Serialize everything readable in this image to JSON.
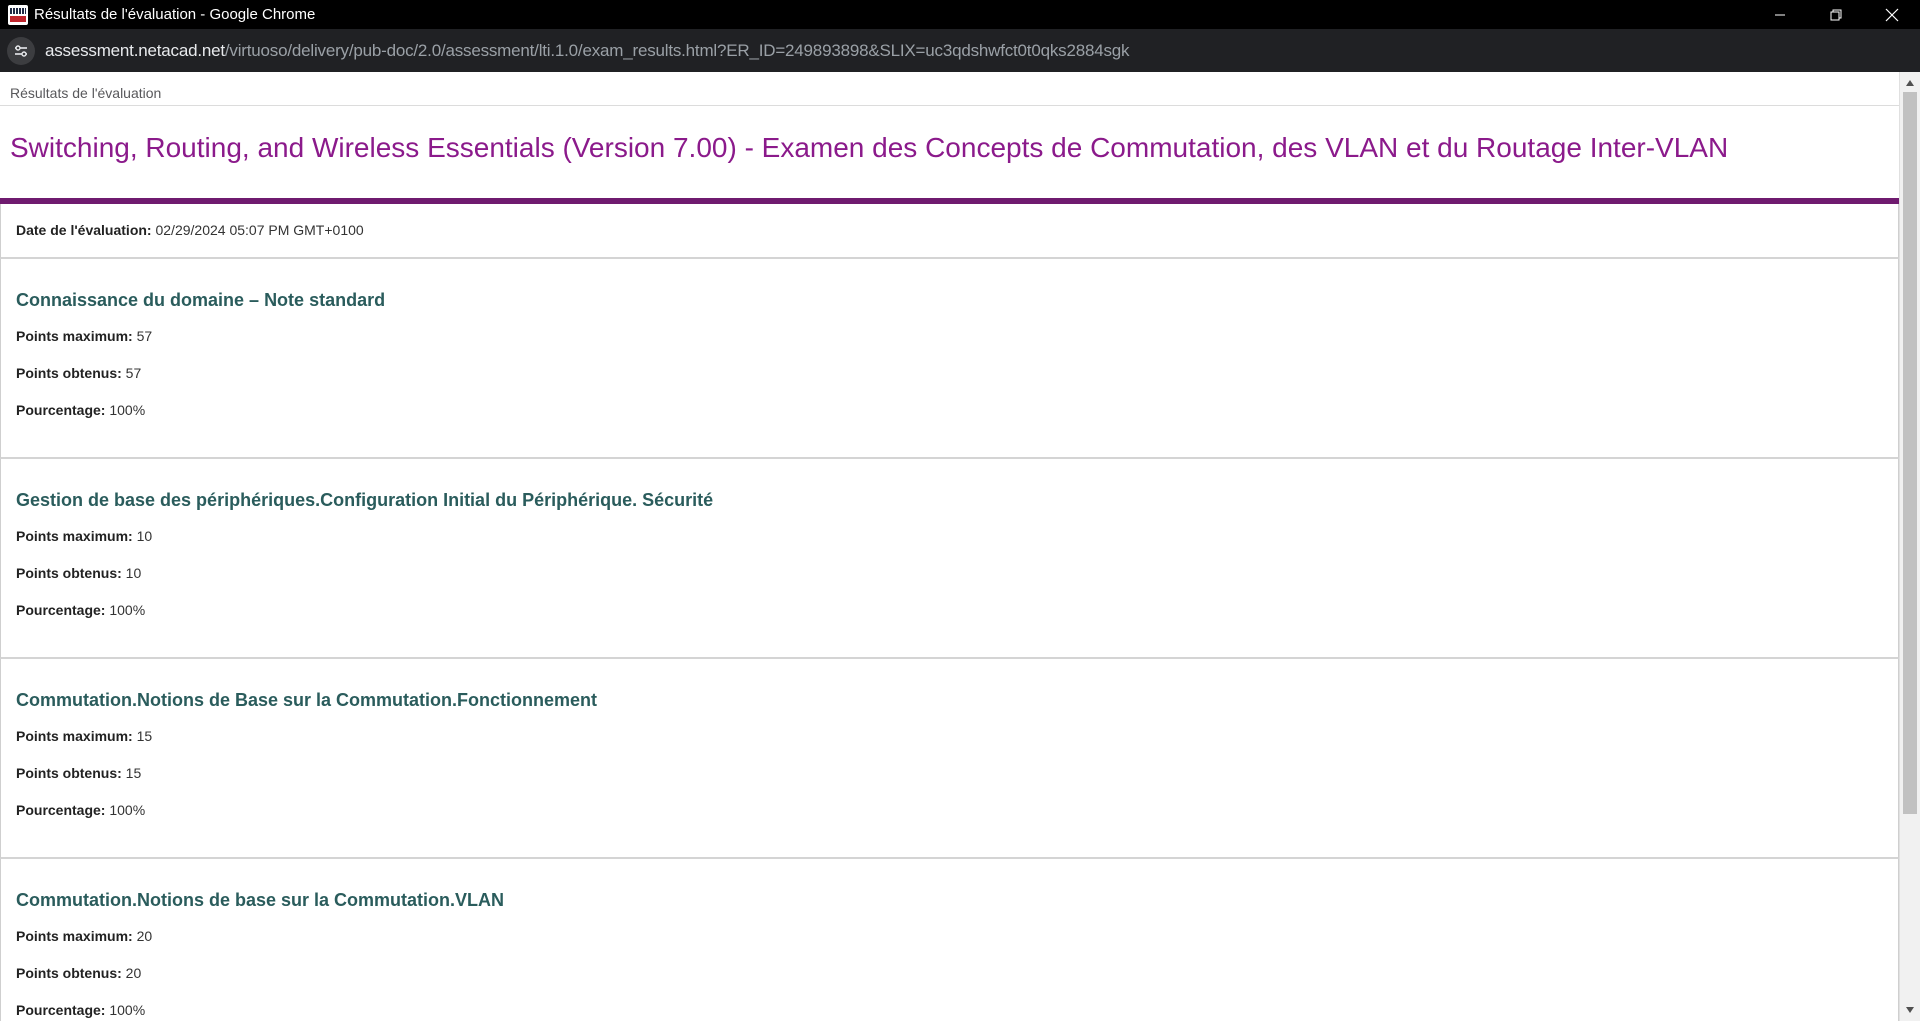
{
  "window": {
    "title": "Résultats de l'évaluation - Google Chrome"
  },
  "addressbar": {
    "url_host": "assessment.netacad.net",
    "url_path": "/virtuoso/delivery/pub-doc/2.0/assessment/lti.1.0/exam_results.html?ER_ID=249893898&SLIX=uc3qdshwfct0t0qks2884sgk"
  },
  "page": {
    "header_small": "Résultats de l'évaluation",
    "exam_title": "Switching, Routing, and Wireless Essentials (Version 7.00) - Examen des Concepts de Commutation, des VLAN et du Routage Inter-VLAN",
    "date_label": "Date de l'évaluation:",
    "date_value": "02/29/2024 05:07 PM GMT+0100"
  },
  "labels": {
    "max": "Points maximum:",
    "earned": "Points obtenus:",
    "percent": "Pourcentage:"
  },
  "sections": [
    {
      "title": "Connaissance du domaine – Note standard",
      "max": "57",
      "earned": "57",
      "percent": "100%"
    },
    {
      "title": "Gestion de base des périphériques.Configuration Initial du Périphérique. Sécurité",
      "max": "10",
      "earned": "10",
      "percent": "100%"
    },
    {
      "title": "Commutation.Notions de Base sur la Commutation.Fonctionnement",
      "max": "15",
      "earned": "15",
      "percent": "100%"
    },
    {
      "title": "Commutation.Notions de base sur la Commutation.VLAN",
      "max": "20",
      "earned": "20",
      "percent": "100%"
    }
  ]
}
